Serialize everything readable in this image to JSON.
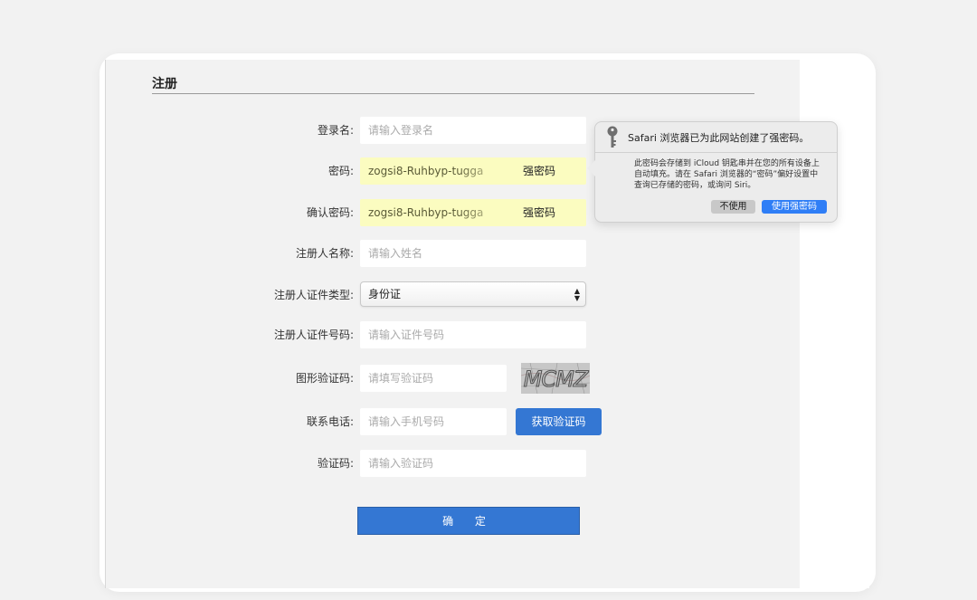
{
  "form": {
    "title": "注册",
    "login_name": {
      "label": "登录名:",
      "placeholder": "请输入登录名"
    },
    "password": {
      "label": "密码:",
      "value": "zogsi8-Ruhbyp-tugga",
      "badge": "强密码"
    },
    "confirm_password": {
      "label": "确认密码:",
      "value": "zogsi8-Ruhbyp-tugga",
      "badge": "强密码"
    },
    "registrant_name": {
      "label": "注册人名称:",
      "placeholder": "请输入姓名"
    },
    "id_type": {
      "label": "注册人证件类型:",
      "selected": "身份证"
    },
    "id_number": {
      "label": "注册人证件号码:",
      "placeholder": "请输入证件号码"
    },
    "captcha": {
      "label": "图形验证码:",
      "placeholder": "请填写验证码",
      "image_text": "MCMZ"
    },
    "phone": {
      "label": "联系电话:",
      "placeholder": "请输入手机号码",
      "button": "获取验证码"
    },
    "sms_code": {
      "label": "验证码:",
      "placeholder": "请输入验证码"
    },
    "submit": "确 定"
  },
  "popover": {
    "title": "Safari 浏览器已为此网站创建了强密码。",
    "body": "此密码会存储到 iCloud 钥匙串并在您的所有设备上自动填充。请在 Safari 浏览器的“密码”偏好设置中查询已存储的密码，或询问 Siri。",
    "decline": "不使用",
    "accept": "使用强密码"
  },
  "colors": {
    "primary": "#3477d3",
    "autofill": "#fbfcc0",
    "popover_accept": "#2f7ef6"
  }
}
